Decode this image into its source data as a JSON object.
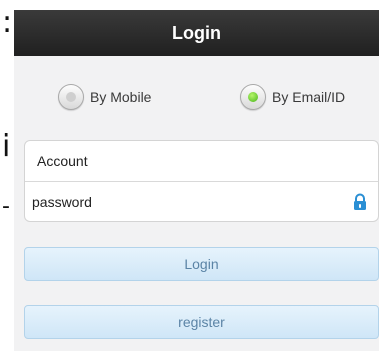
{
  "background": {
    "glyphs": [
      ":",
      "i",
      "-"
    ]
  },
  "titlebar": {
    "title": "Login"
  },
  "login_mode": {
    "options": [
      {
        "label": "By Mobile",
        "selected": false
      },
      {
        "label": "By Email/ID",
        "selected": true
      }
    ],
    "selected_color": "#47b51b"
  },
  "form": {
    "account_placeholder": "Account",
    "password_placeholder": "password",
    "lock_icon": "lock-icon",
    "lock_color": "#2a8fd4"
  },
  "buttons": {
    "login_label": "Login",
    "register_label": "register"
  }
}
